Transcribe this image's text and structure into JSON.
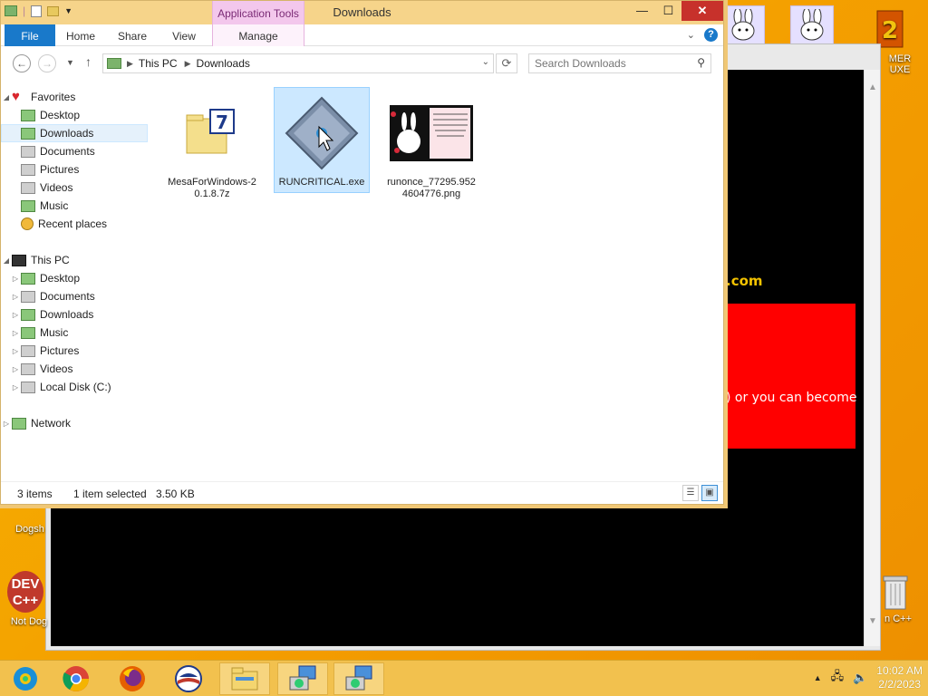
{
  "window": {
    "title": "Downloads",
    "app_tools": "Application Tools"
  },
  "ribbon": {
    "file": "File",
    "home": "Home",
    "share": "Share",
    "view": "View",
    "manage": "Manage"
  },
  "address": {
    "crumbs": [
      "This PC",
      "Downloads"
    ],
    "search_placeholder": "Search Downloads"
  },
  "nav": {
    "favorites": "Favorites",
    "fav_items": [
      "Desktop",
      "Downloads",
      "Documents",
      "Pictures",
      "Videos",
      "Music",
      "Recent places"
    ],
    "this_pc": "This PC",
    "pc_items": [
      "Desktop",
      "Documents",
      "Downloads",
      "Music",
      "Pictures",
      "Videos",
      "Local Disk (C:)"
    ],
    "network": "Network",
    "selected": "Downloads"
  },
  "files": [
    {
      "name": "MesaForWindows-20.1.8.7z",
      "type": "archive",
      "selected": false
    },
    {
      "name": "RUNCRITICAL.exe",
      "type": "exe",
      "selected": true
    },
    {
      "name": "runonce_77295.9524604776.png",
      "type": "image",
      "selected": false
    }
  ],
  "status": {
    "items": "3 items",
    "selected": "1 item selected",
    "size": "3.50 KB"
  },
  "background": {
    "link_text": ".com",
    "red_text": ") or you can become"
  },
  "desktop_icons": {
    "right_label_1": "MER",
    "right_label_2": "UXE",
    "left_label_1": "Dogsh",
    "left_label_2": "Not Dog",
    "dev_text": "DEV",
    "dev_sub": "C++",
    "right_bottom": "n C++"
  },
  "taskbar": {
    "time": "10:02 AM",
    "date": "2/2/2023"
  },
  "colors": {
    "accent": "#1979ca",
    "title_bar": "#f6d48a",
    "close": "#c7312b",
    "taskbar": "#f2c14e"
  }
}
